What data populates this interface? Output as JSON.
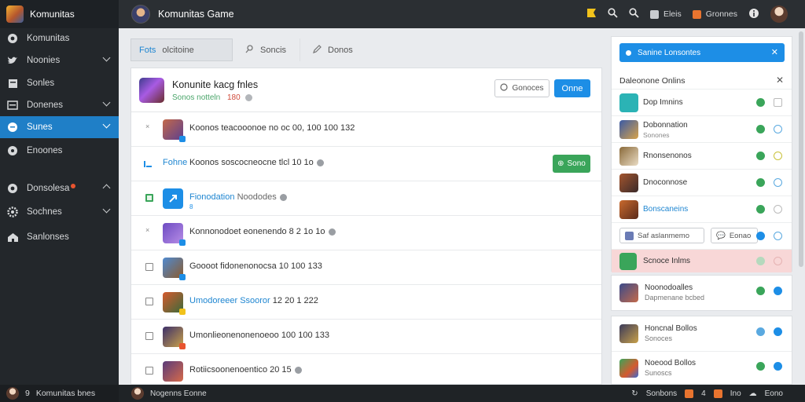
{
  "app": {
    "name": "Komunitas",
    "title": "Komunitas Game"
  },
  "sidebar": {
    "items": [
      {
        "label": "Komunitas",
        "icon": "gear-icon"
      },
      {
        "label": "Noonies",
        "icon": "twitter-bird-icon"
      },
      {
        "label": "Sonles",
        "icon": "grid-square-icon"
      },
      {
        "label": "Donenes",
        "icon": "list-icon"
      },
      {
        "label": "Sunes",
        "icon": "chat-bubble-icon"
      },
      {
        "label": "Enoones",
        "icon": "help-icon"
      },
      {
        "label": "Donsolesa",
        "icon": "settings-icon"
      },
      {
        "label": "Sochnes",
        "icon": "cog-icon"
      },
      {
        "label": "Sanlonses",
        "icon": "home-icon"
      }
    ],
    "footer_user": "Komunitas bnes",
    "footer_prefix": "9"
  },
  "topbar": {
    "btn_a": "Eleis",
    "btn_b": "Gronnes"
  },
  "tabs": [
    {
      "label": "Fots",
      "sub": "olcitoine"
    },
    {
      "label": "Soncis"
    },
    {
      "label": "Donos"
    }
  ],
  "main": {
    "header_title": "Konunite kacg fnles",
    "header_meta_a": "Sonos notteln",
    "header_meta_b": "180",
    "header_rating": "☆",
    "outline_btn": "Gonoces",
    "primary_btn": "Onne",
    "rows": [
      {
        "text": "Koonos teacooonoe no oc 00, 100 100 132",
        "link": false
      },
      {
        "lead": "Fohne",
        "text": "Koonos soscocneocne tlcl 10 1o",
        "link": false,
        "action": "Sono"
      },
      {
        "text": "Fionodation",
        "text2": "Noododes",
        "link": true,
        "sub": "8"
      },
      {
        "text": "Konnonodoet eonenendo 8 2 1o 1o",
        "link": false
      },
      {
        "text": "Goooot fidonenonocsa 10 100 133",
        "link": false
      },
      {
        "text": "Umodoreeer Ssooror",
        "text2": "12 20 1 222",
        "link": true
      },
      {
        "text": "Umonlieonenonenoeoo 100 100 133",
        "link": false
      },
      {
        "text": "Rotiicsoonenoentico 20 15",
        "link": false
      }
    ]
  },
  "right_panel": {
    "alert": "Sanine Lonsontes",
    "heading": "Daleonone Onlins",
    "rows": [
      {
        "name": "Dop Imnins",
        "sub": ""
      },
      {
        "name": "Dobonnation",
        "sub": "Sonones"
      },
      {
        "name": "Rnonsenonos",
        "sub": ""
      },
      {
        "name": "Dnoconnose",
        "sub": ""
      },
      {
        "name": "Bonscaneins",
        "sub": ""
      }
    ],
    "split_a": "Saf aslanmemo",
    "split_b": "Eonao",
    "pink_row": "Scnoce Inlms"
  },
  "cards": [
    {
      "name": "Noonodoalles",
      "sub": "Dapmenane bcbed"
    },
    {
      "name": "Honcnal Bollos",
      "sub": "Sonoces"
    },
    {
      "name": "Noeood Bollos",
      "sub": "Sunoscs"
    }
  ],
  "status": {
    "user": "Nogenns Eonne",
    "right_a": "Sonbons",
    "right_b": "4",
    "right_c": "Ino",
    "right_d": "Eono"
  }
}
